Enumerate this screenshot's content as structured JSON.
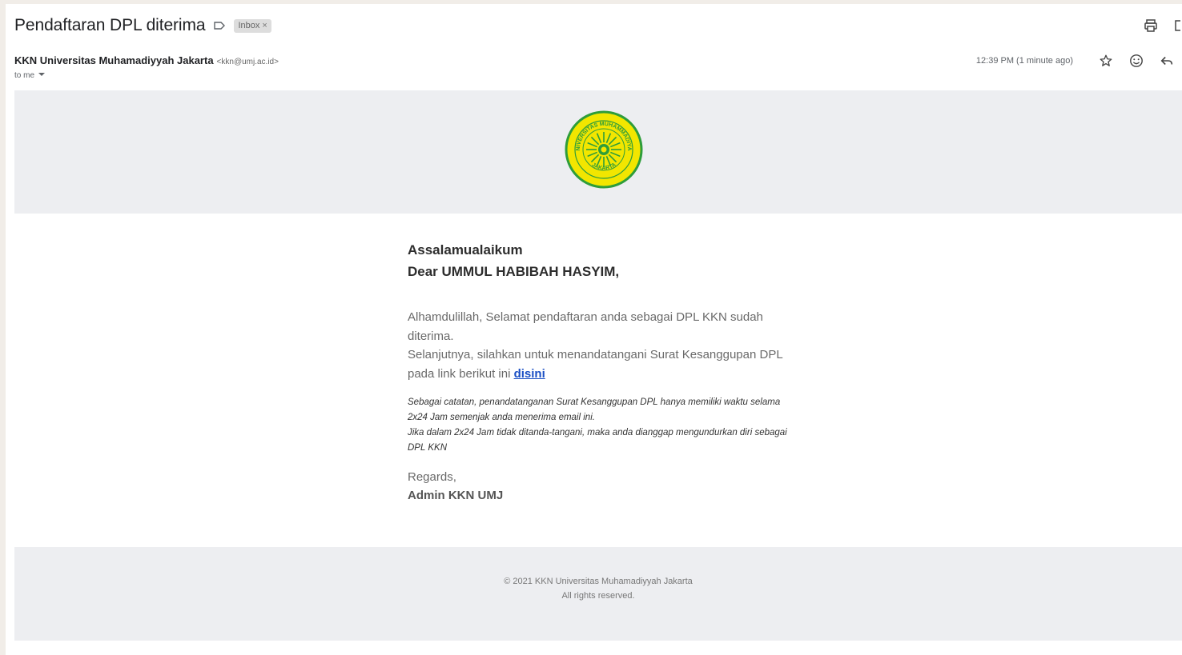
{
  "email": {
    "subject": "Pendaftaran DPL diterima",
    "label_chip": "Inbox",
    "label_chip_close": "×",
    "sender_name": "KKN Universitas Muhamadiyyah Jakarta",
    "sender_email": "<kkn@umj.ac.id>",
    "to_line": "to me",
    "timestamp": "12:39 PM (1 minute ago)"
  },
  "icons": {
    "label": "label-outline-icon",
    "print": "print-icon",
    "open_new": "open-in-new-icon",
    "star": "star-icon",
    "emoji": "emoji-reaction-icon",
    "reply": "reply-icon",
    "logo": "university-seal-logo"
  },
  "logo_lettering": {
    "top": "UNIVERSITAS MUHAMMADIYAH",
    "bottom": "JAKARTA"
  },
  "body": {
    "greeting": "Assalamualaikum",
    "dear": "Dear UMMUL HABIBAH HASYIM,",
    "para_line1": "Alhamdulillah, Selamat pendaftaran anda sebagai DPL KKN sudah diterima.",
    "para_line2": "Selanjutnya, silahkan untuk menandatangani Surat Kesanggupan DPL pada link berikut ini",
    "link_text": "disini",
    "note_line1": "Sebagai catatan, penandatanganan Surat Kesanggupan DPL hanya memiliki waktu selama 2x24 Jam semenjak anda menerima email ini.",
    "note_line2": "Jika dalam 2x24 Jam tidak ditanda-tangani, maka anda dianggap mengundurkan diri sebagai DPL KKN",
    "regards": "Regards,",
    "signature": "Admin KKN UMJ"
  },
  "footer": {
    "copyright": "© 2021 KKN Universitas Muhamadiyyah Jakarta",
    "rights": "All rights reserved."
  },
  "colors": {
    "link": "#1a4fc4",
    "panel_bg": "#edeef1",
    "seal_yellow": "#f2e600",
    "seal_green": "#2e9d3a"
  }
}
